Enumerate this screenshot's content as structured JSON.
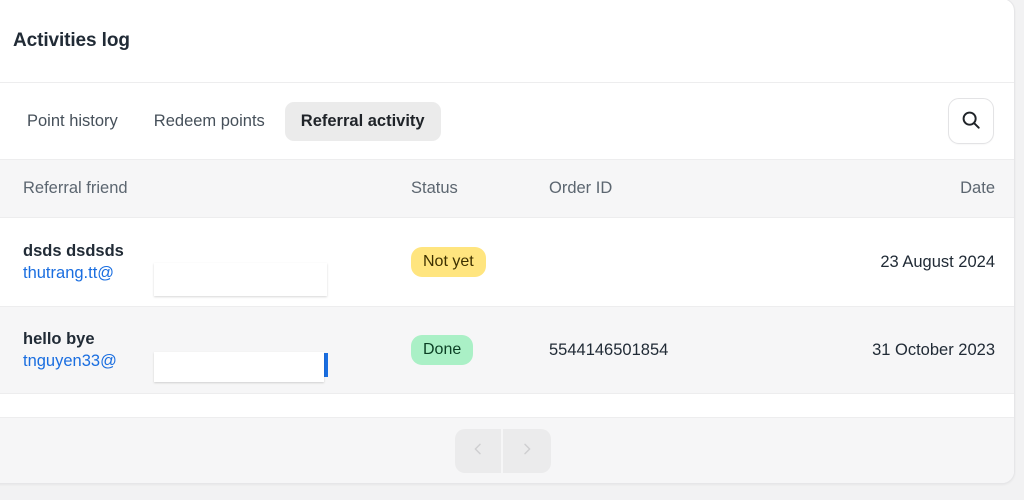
{
  "card": {
    "title": "Activities log"
  },
  "tabs": [
    {
      "label": "Point history",
      "active": false
    },
    {
      "label": "Redeem points",
      "active": false
    },
    {
      "label": "Referral activity",
      "active": true
    }
  ],
  "search": {
    "icon": "search-icon",
    "label": "Search"
  },
  "table": {
    "columns": [
      {
        "key": "friend",
        "label": "Referral friend"
      },
      {
        "key": "status",
        "label": "Status"
      },
      {
        "key": "order",
        "label": "Order ID"
      },
      {
        "key": "date",
        "label": "Date"
      }
    ],
    "rows": [
      {
        "name": "dsds dsdsds",
        "email": "thutrang.tt@",
        "status": "Not yet",
        "status_kind": "pending",
        "order_id": "",
        "date": "23 August 2024"
      },
      {
        "name": "hello bye",
        "email": "tnguyen33@",
        "status": "Done",
        "status_kind": "done",
        "order_id": "5544146501854",
        "date": "31 October 2023"
      }
    ]
  },
  "pagination": {
    "prev_icon": "chevron-left-icon",
    "next_icon": "chevron-right-icon",
    "prev_label": "Previous page",
    "next_label": "Next page"
  },
  "colors": {
    "link": "#1a6ee0",
    "badge_pending_bg": "#ffe57f",
    "badge_done_bg": "#aaf0c6",
    "active_tab_bg": "#ebebeb",
    "row_alt_bg": "#f6f6f7"
  }
}
